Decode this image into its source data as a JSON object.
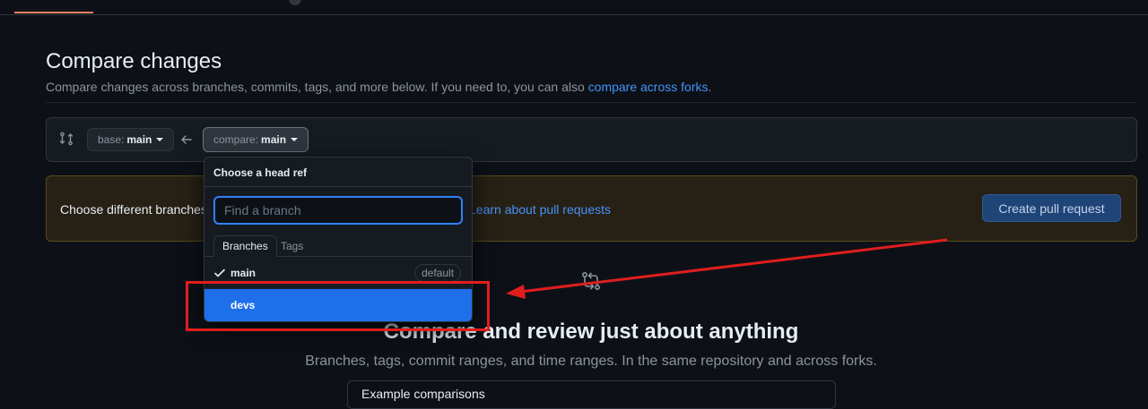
{
  "page": {
    "title": "Compare changes",
    "subtitle_prefix": "Compare changes across branches, commits, tags, and more below. If you need to, you can also ",
    "subtitle_link": "compare across forks",
    "subtitle_suffix": "."
  },
  "range": {
    "base_label": "base:",
    "base_value": "main",
    "compare_label": "compare:",
    "compare_value": "main"
  },
  "flash": {
    "text": "Choose different branches",
    "link": "Learn about pull requests",
    "button": "Create pull request"
  },
  "hero": {
    "title": "Compare and review just about anything",
    "subtitle": "Branches, tags, commit ranges, and time ranges. In the same repository and across forks.",
    "example_text": "Example comparisons"
  },
  "dropdown": {
    "title": "Choose a head ref",
    "placeholder": "Find a branch",
    "tabs": [
      "Branches",
      "Tags"
    ],
    "items": [
      {
        "label": "main",
        "badge": "default",
        "selected": true
      },
      {
        "label": "devs",
        "highlighted": true
      }
    ]
  },
  "colors": {
    "accent": "#1f6feb",
    "link": "#4493f8",
    "annotation": "#e01e1e",
    "background": "#0d1117"
  }
}
